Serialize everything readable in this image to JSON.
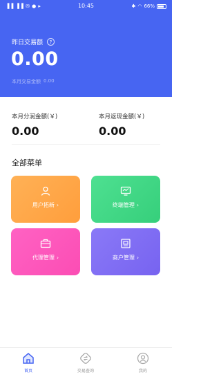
{
  "statusbar": {
    "left_icons": "▐▐ ▐▐ ✉ ● ▸",
    "time": "10:45",
    "battery": "66%"
  },
  "hero": {
    "label": "昨日交易额",
    "help": "?",
    "value": "0.00",
    "sub_label": "本月交易金额",
    "sub_value": "0.00"
  },
  "stats": [
    {
      "label": "本月分润金额(￥)",
      "value": "0.00"
    },
    {
      "label": "本月返现金额(￥)",
      "value": "0.00"
    }
  ],
  "menu": {
    "title": "全部菜单",
    "tiles": [
      {
        "label": "用户拓新",
        "icon": "user-icon",
        "color": "#ffa849"
      },
      {
        "label": "终端管理",
        "icon": "monitor-icon",
        "color": "#42d886"
      },
      {
        "label": "代理管理",
        "icon": "briefcase-icon",
        "color": "#fd58bc"
      },
      {
        "label": "商户管理",
        "icon": "store-icon",
        "color": "#806ef3"
      }
    ],
    "chevron": "›"
  },
  "tabbar": [
    {
      "label": "首页",
      "icon": "home-icon",
      "active": true
    },
    {
      "label": "交易查询",
      "icon": "exchange-icon",
      "active": false
    },
    {
      "label": "我的",
      "icon": "profile-icon",
      "active": false
    }
  ],
  "colors": {
    "primary": "#4765f2"
  }
}
